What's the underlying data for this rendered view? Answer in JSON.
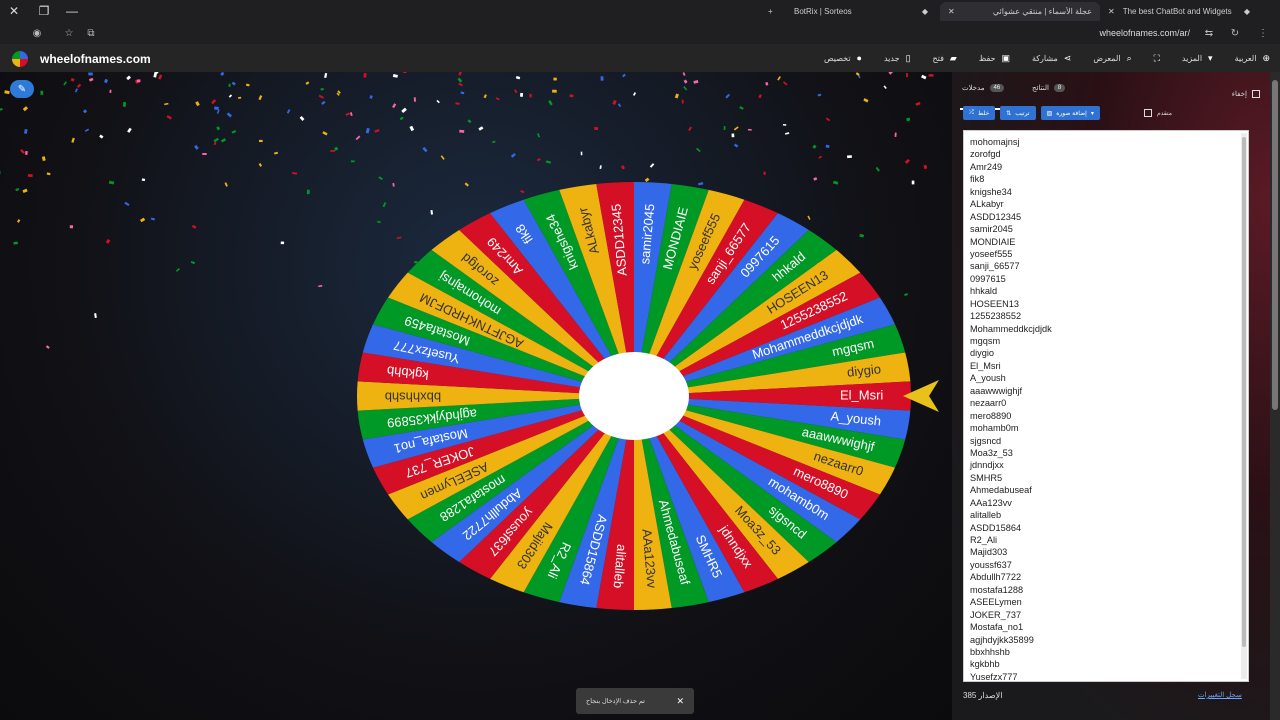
{
  "browser": {
    "tabs": [
      {
        "title": "BotRix | Sorteos"
      },
      {
        "title": "عجلة الأسماء | منتقي عشوائي"
      },
      {
        "title": "The best ChatBot and Widgets"
      }
    ],
    "new_tab": "+",
    "url": "wheelofnames.com/ar/"
  },
  "app": {
    "brand": "wheelofnames.com",
    "menu": [
      {
        "label": "تخصيص",
        "icon": "palette-icon"
      },
      {
        "label": "جديد",
        "icon": "file-icon"
      },
      {
        "label": "فتح",
        "icon": "folder-open-icon"
      },
      {
        "label": "حفظ",
        "icon": "save-icon"
      },
      {
        "label": "مشاركة",
        "icon": "share-icon"
      },
      {
        "label": "المعرض",
        "icon": "search-icon"
      },
      {
        "label": "",
        "icon": "fullscreen-icon"
      },
      {
        "label": "المزيد",
        "icon": "caret-down-icon"
      },
      {
        "label": "العربية",
        "icon": "globe-icon"
      }
    ]
  },
  "wheel": {
    "colors": [
      "#009925",
      "#eeb211",
      "#d50f25",
      "#3369e8"
    ],
    "entries": [
      "mohomajnsj",
      "zorofgd",
      "Amr249",
      "fik8",
      "knigshe34",
      "ALkabyr",
      "ASDD12345",
      "samir2045",
      "MONDIAIE",
      "yoseef555",
      "sanji_66577",
      "0997615",
      "hhkald",
      "HOSEEN13",
      "1255238552",
      "Mohammeddkcjdjdk",
      "mgqsm",
      "diygio",
      "El_Msri",
      "A_yoush",
      "aaawwwighjf",
      "nezaarr0",
      "mero8890",
      "mohamb0m",
      "sjgsncd",
      "Moa3z_53",
      "jdnndjxx",
      "SMHR5",
      "Ahmedabuseaf",
      "AAa123vv",
      "alitalleb",
      "ASDD15864",
      "R2_Ali",
      "Majid303",
      "youssf637",
      "Abdullh7722",
      "mostafa1288",
      "ASEELymen",
      "JOKER_737",
      "Mostafa_no1",
      "agjhdyjkk35899",
      "bbxhhshb",
      "kgkbhb",
      "Yusefzx777",
      "Mostafa459",
      "AGJFTNKHRDFJM"
    ]
  },
  "toast": {
    "text": "تم حذف الإدخال بنجاح",
    "close": "✕"
  },
  "panel": {
    "tabs": [
      {
        "label": "مدخلات",
        "count": "46"
      },
      {
        "label": "النتائج",
        "count": "8"
      }
    ],
    "hide_label": "إخفاء",
    "buttons": {
      "shuffle": "خلط",
      "sort": "ترتيب",
      "add_image": "إضافة صورة"
    },
    "advanced_label": "متقدم",
    "entries": [
      "mohomajnsj",
      "zorofgd",
      "Amr249",
      "fik8",
      "knigshe34",
      "ALkabyr",
      "ASDD12345",
      "samir2045",
      "MONDIAIE",
      "yoseef555",
      "sanji_66577",
      "0997615",
      "hhkald",
      "HOSEEN13",
      "1255238552",
      "Mohammeddkcjdjdk",
      "mgqsm",
      "diygio",
      "El_Msri",
      "A_yoush",
      "aaawwwighjf",
      "nezaarr0",
      "mero8890",
      "mohamb0m",
      "sjgsncd",
      "Moa3z_53",
      "jdnndjxx",
      "SMHR5",
      "Ahmedabuseaf",
      "AAa123vv",
      "alitalleb",
      "ASDD15864",
      "R2_Ali",
      "Majid303",
      "youssf637",
      "Abdullh7722",
      "mostafa1288",
      "ASEELymen",
      "JOKER_737",
      "Mostafa_no1",
      "agjhdyjkk35899",
      "bbxhhshb",
      "kgkbhb",
      "Yusefzx777"
    ],
    "version": "الإصدار 385",
    "changelog": "سجل التغييرات"
  }
}
